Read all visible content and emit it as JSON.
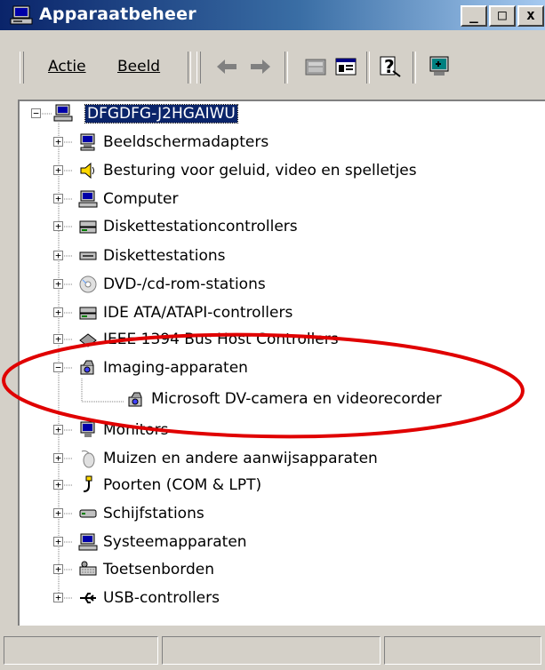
{
  "window": {
    "title": "Apparaatbeheer",
    "buttons": {
      "minimize": "_",
      "maximize": "□",
      "close": "x"
    }
  },
  "menu": {
    "actie": "Actie",
    "beeld": "Beeld"
  },
  "tree": {
    "root": "DFGDFG-J2HGAIWU",
    "items": [
      {
        "label": "Beeldschermadapters",
        "icon": "display-adapter-icon"
      },
      {
        "label": "Besturing voor geluid, video en spelletjes",
        "icon": "speaker-icon"
      },
      {
        "label": "Computer",
        "icon": "computer-icon"
      },
      {
        "label": "Diskettestationcontrollers",
        "icon": "controller-icon"
      },
      {
        "label": "Diskettestations",
        "icon": "floppy-drive-icon"
      },
      {
        "label": "DVD-/cd-rom-stations",
        "icon": "cd-icon"
      },
      {
        "label": "IDE ATA/ATAPI-controllers",
        "icon": "controller-icon"
      },
      {
        "label": "IEEE 1394 Bus Host Controllers",
        "icon": "firewire-icon"
      },
      {
        "label": "Imaging-apparaten",
        "icon": "camera-icon",
        "expanded": true
      },
      {
        "label": "Microsoft DV-camera en videorecorder",
        "icon": "camera-icon",
        "child": true
      },
      {
        "label": "Monitors",
        "icon": "monitor-icon"
      },
      {
        "label": "Muizen en andere aanwijsapparaten",
        "icon": "mouse-icon"
      },
      {
        "label": "Poorten (COM & LPT)",
        "icon": "port-icon"
      },
      {
        "label": "Schijfstations",
        "icon": "disk-drive-icon"
      },
      {
        "label": "Systeemapparaten",
        "icon": "system-device-icon"
      },
      {
        "label": "Toetsenborden",
        "icon": "keyboard-icon"
      },
      {
        "label": "USB-controllers",
        "icon": "usb-icon"
      }
    ]
  },
  "colors": {
    "titlebar": "#0a246a",
    "selection": "#0a246a",
    "annotation": "#e00000",
    "face": "#d4d0c8"
  }
}
